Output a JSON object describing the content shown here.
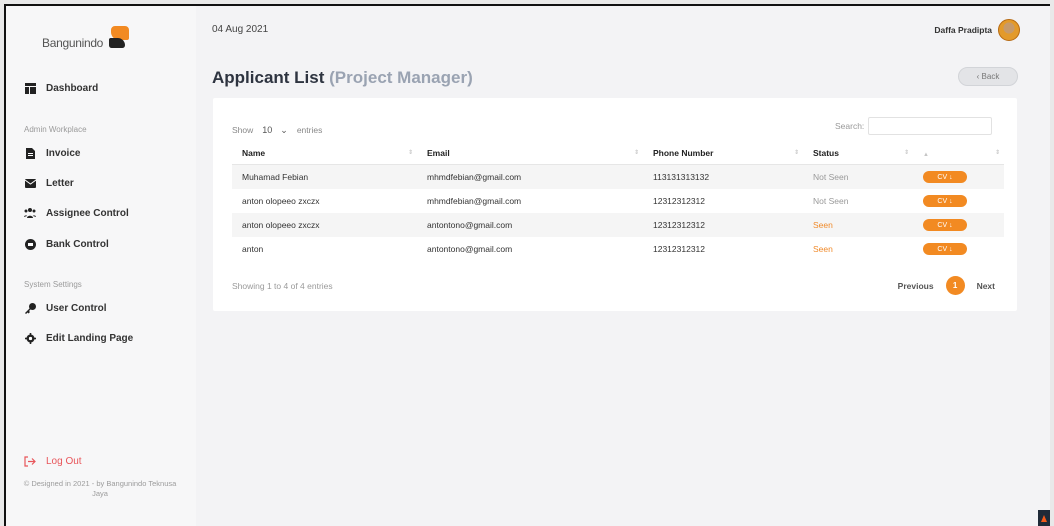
{
  "brand": {
    "name": "Bangunindo"
  },
  "sidebar": {
    "dashboard": {
      "label": "Dashboard"
    },
    "admin_section": "Admin Workplace",
    "admin_items": [
      {
        "label": "Invoice",
        "icon": "file-icon"
      },
      {
        "label": "Letter",
        "icon": "envelope-icon"
      },
      {
        "label": "Assignee Control",
        "icon": "users-icon"
      },
      {
        "label": "Bank Control",
        "icon": "circle-icon"
      }
    ],
    "system_section": "System Settings",
    "system_items": [
      {
        "label": "User Control",
        "icon": "key-icon"
      },
      {
        "label": "Edit Landing Page",
        "icon": "gear-icon"
      }
    ],
    "logout": {
      "label": "Log Out",
      "icon": "logout-icon"
    },
    "copyright": "© Designed in 2021 - by Bangunindo Teknusa Jaya"
  },
  "header": {
    "date": "04 Aug 2021",
    "user_name": "Daffa Pradipta"
  },
  "page": {
    "title": "Applicant List",
    "subtitle": "(Project Manager)",
    "back_label": "‹ Back"
  },
  "table": {
    "show_label": "Show",
    "entries_value": "10",
    "entries_label": "entries",
    "search_label": "Search:",
    "search_value": "",
    "columns": [
      "Name",
      "Email",
      "Phone Number",
      "Status",
      ""
    ],
    "rows": [
      {
        "name": "Muhamad Febian",
        "email": "mhmdfebian@gmail.com",
        "phone": "113131313132",
        "status": "Not Seen",
        "cv": "CV ↓"
      },
      {
        "name": "anton olopeeo zxczx",
        "email": "mhmdfebian@gmail.com",
        "phone": "12312312312",
        "status": "Not Seen",
        "cv": "CV ↓"
      },
      {
        "name": "anton olopeeo zxczx",
        "email": "antontono@gmail.com",
        "phone": "12312312312",
        "status": "Seen",
        "cv": "CV ↓"
      },
      {
        "name": "anton",
        "email": "antontono@gmail.com",
        "phone": "12312312312",
        "status": "Seen",
        "cv": "CV ↓"
      }
    ],
    "info": "Showing 1 to 4 of 4 entries",
    "pagination": {
      "previous": "Previous",
      "current": "1",
      "next": "Next"
    }
  },
  "colors": {
    "accent": "#f28a22",
    "seen": "#f08a2a",
    "not_seen": "#999999",
    "logout": "#e8555a"
  }
}
